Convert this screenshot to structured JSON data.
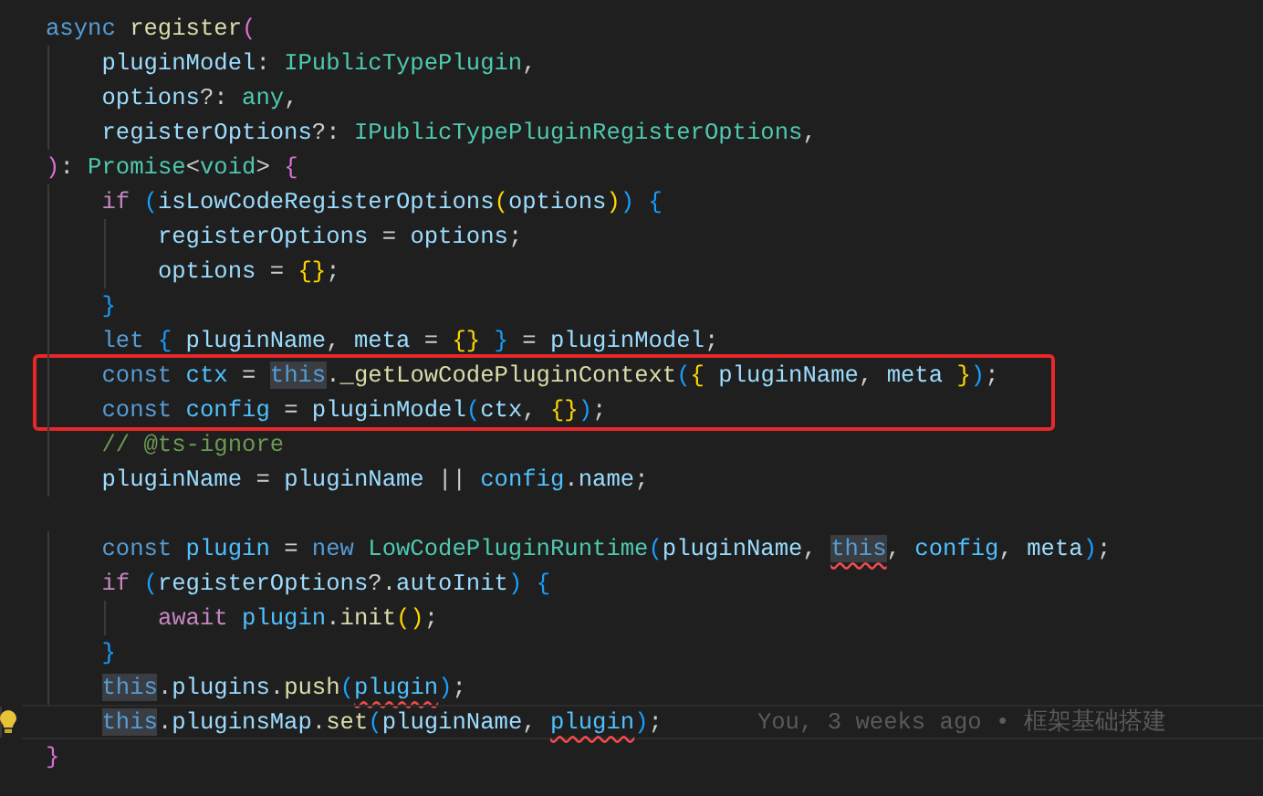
{
  "editor": {
    "lines": [
      {
        "kind": "code",
        "tokens": [
          {
            "kind": "kw",
            "text": "async "
          },
          {
            "kind": "fn",
            "text": "register"
          },
          {
            "kind": "b2",
            "text": "("
          }
        ]
      },
      {
        "kind": "code",
        "tokens": [
          {
            "kind": "var",
            "text": "    pluginModel"
          },
          {
            "kind": "punc",
            "text": ": "
          },
          {
            "kind": "type",
            "text": "IPublicTypePlugin"
          },
          {
            "kind": "punc",
            "text": ","
          }
        ]
      },
      {
        "kind": "code",
        "tokens": [
          {
            "kind": "var",
            "text": "    options"
          },
          {
            "kind": "punc",
            "text": "?: "
          },
          {
            "kind": "type",
            "text": "any"
          },
          {
            "kind": "punc",
            "text": ","
          }
        ]
      },
      {
        "kind": "code",
        "tokens": [
          {
            "kind": "var",
            "text": "    registerOptions"
          },
          {
            "kind": "punc",
            "text": "?: "
          },
          {
            "kind": "type",
            "text": "IPublicTypePluginRegisterOptions"
          },
          {
            "kind": "punc",
            "text": ","
          }
        ]
      },
      {
        "kind": "code",
        "tokens": [
          {
            "kind": "b2",
            "text": ")"
          },
          {
            "kind": "punc",
            "text": ": "
          },
          {
            "kind": "type",
            "text": "Promise"
          },
          {
            "kind": "punc",
            "text": "<"
          },
          {
            "kind": "type",
            "text": "void"
          },
          {
            "kind": "punc",
            "text": "> "
          },
          {
            "kind": "b2",
            "text": "{"
          }
        ]
      },
      {
        "kind": "code",
        "tokens": [
          {
            "kind": "ctrl",
            "text": "    if "
          },
          {
            "kind": "b3",
            "text": "("
          },
          {
            "kind": "var",
            "text": "isLowCodeRegisterOptions"
          },
          {
            "kind": "b1",
            "text": "("
          },
          {
            "kind": "var",
            "text": "options"
          },
          {
            "kind": "b1",
            "text": ")"
          },
          {
            "kind": "b3",
            "text": ")"
          },
          {
            "kind": "b3",
            "text": " {"
          }
        ]
      },
      {
        "kind": "code",
        "tokens": [
          {
            "kind": "var",
            "text": "        registerOptions"
          },
          {
            "kind": "punc",
            "text": " = "
          },
          {
            "kind": "var",
            "text": "options"
          },
          {
            "kind": "punc",
            "text": ";"
          }
        ]
      },
      {
        "kind": "code",
        "tokens": [
          {
            "kind": "var",
            "text": "        options"
          },
          {
            "kind": "punc",
            "text": " = "
          },
          {
            "kind": "b1",
            "text": "{}"
          },
          {
            "kind": "punc",
            "text": ";"
          }
        ]
      },
      {
        "kind": "code",
        "tokens": [
          {
            "kind": "b3",
            "text": "    }"
          }
        ]
      },
      {
        "kind": "code",
        "tokens": [
          {
            "kind": "kw",
            "text": "    let "
          },
          {
            "kind": "b3",
            "text": "{ "
          },
          {
            "kind": "var",
            "text": "pluginName"
          },
          {
            "kind": "punc",
            "text": ", "
          },
          {
            "kind": "var",
            "text": "meta"
          },
          {
            "kind": "punc",
            "text": " = "
          },
          {
            "kind": "b1",
            "text": "{}"
          },
          {
            "kind": "b3",
            "text": " }"
          },
          {
            "kind": "punc",
            "text": " = "
          },
          {
            "kind": "var",
            "text": "pluginModel"
          },
          {
            "kind": "punc",
            "text": ";"
          }
        ]
      },
      {
        "kind": "code",
        "boxed": true,
        "tokens": [
          {
            "kind": "kw",
            "text": "    const "
          },
          {
            "kind": "const",
            "text": "ctx"
          },
          {
            "kind": "punc",
            "text": " = "
          },
          {
            "kind": "kw",
            "text": "this",
            "highlighted": true
          },
          {
            "kind": "punc",
            "text": "."
          },
          {
            "kind": "fn",
            "text": "_getLowCodePluginContext"
          },
          {
            "kind": "b3",
            "text": "("
          },
          {
            "kind": "b1",
            "text": "{ "
          },
          {
            "kind": "var",
            "text": "pluginName"
          },
          {
            "kind": "punc",
            "text": ", "
          },
          {
            "kind": "var",
            "text": "meta"
          },
          {
            "kind": "b1",
            "text": " }"
          },
          {
            "kind": "b3",
            "text": ")"
          },
          {
            "kind": "punc",
            "text": ";"
          }
        ]
      },
      {
        "kind": "code",
        "boxed": true,
        "tokens": [
          {
            "kind": "kw",
            "text": "    const "
          },
          {
            "kind": "const",
            "text": "config"
          },
          {
            "kind": "punc",
            "text": " = "
          },
          {
            "kind": "var",
            "text": "pluginModel"
          },
          {
            "kind": "b3",
            "text": "("
          },
          {
            "kind": "var",
            "text": "ctx"
          },
          {
            "kind": "punc",
            "text": ", "
          },
          {
            "kind": "b1",
            "text": "{}"
          },
          {
            "kind": "b3",
            "text": ")"
          },
          {
            "kind": "punc",
            "text": ";"
          }
        ]
      },
      {
        "kind": "code",
        "tokens": [
          {
            "kind": "comment",
            "text": "    // @ts-ignore"
          }
        ]
      },
      {
        "kind": "code",
        "tokens": [
          {
            "kind": "var",
            "text": "    pluginName"
          },
          {
            "kind": "punc",
            "text": " = "
          },
          {
            "kind": "var",
            "text": "pluginName"
          },
          {
            "kind": "punc",
            "text": " || "
          },
          {
            "kind": "const",
            "text": "config"
          },
          {
            "kind": "punc",
            "text": "."
          },
          {
            "kind": "var",
            "text": "name"
          },
          {
            "kind": "punc",
            "text": ";"
          }
        ]
      },
      {
        "kind": "blank"
      },
      {
        "kind": "code",
        "tokens": [
          {
            "kind": "kw",
            "text": "    const "
          },
          {
            "kind": "const",
            "text": "plugin"
          },
          {
            "kind": "punc",
            "text": " = "
          },
          {
            "kind": "kw",
            "text": "new "
          },
          {
            "kind": "type",
            "text": "LowCodePluginRuntime"
          },
          {
            "kind": "b3",
            "text": "("
          },
          {
            "kind": "var",
            "text": "pluginName"
          },
          {
            "kind": "punc",
            "text": ", "
          },
          {
            "kind": "kw",
            "text": "this",
            "highlighted": true,
            "error": true
          },
          {
            "kind": "punc",
            "text": ", "
          },
          {
            "kind": "const",
            "text": "config"
          },
          {
            "kind": "punc",
            "text": ", "
          },
          {
            "kind": "var",
            "text": "meta"
          },
          {
            "kind": "b3",
            "text": ")"
          },
          {
            "kind": "punc",
            "text": ";"
          }
        ]
      },
      {
        "kind": "code",
        "tokens": [
          {
            "kind": "ctrl",
            "text": "    if "
          },
          {
            "kind": "b3",
            "text": "("
          },
          {
            "kind": "var",
            "text": "registerOptions"
          },
          {
            "kind": "punc",
            "text": "?."
          },
          {
            "kind": "var",
            "text": "autoInit"
          },
          {
            "kind": "b3",
            "text": ")"
          },
          {
            "kind": "b3",
            "text": " {"
          }
        ]
      },
      {
        "kind": "code",
        "tokens": [
          {
            "kind": "ctrl",
            "text": "        await "
          },
          {
            "kind": "const",
            "text": "plugin"
          },
          {
            "kind": "punc",
            "text": "."
          },
          {
            "kind": "fn",
            "text": "init"
          },
          {
            "kind": "b1",
            "text": "()"
          },
          {
            "kind": "punc",
            "text": ";"
          }
        ]
      },
      {
        "kind": "code",
        "tokens": [
          {
            "kind": "b3",
            "text": "    }"
          }
        ]
      },
      {
        "kind": "code",
        "tokens": [
          {
            "kind": "kw",
            "text": "    this",
            "highlighted": true
          },
          {
            "kind": "punc",
            "text": "."
          },
          {
            "kind": "var",
            "text": "plugins"
          },
          {
            "kind": "punc",
            "text": "."
          },
          {
            "kind": "fn",
            "text": "push"
          },
          {
            "kind": "b3",
            "text": "("
          },
          {
            "kind": "const",
            "text": "plugin",
            "error": true
          },
          {
            "kind": "b3",
            "text": ")"
          },
          {
            "kind": "punc",
            "text": ";"
          }
        ]
      },
      {
        "kind": "code",
        "current": true,
        "lightbulb": true,
        "blame": "You, 3 weeks ago • 框架基础搭建",
        "tokens": [
          {
            "kind": "kw",
            "text": "    this",
            "highlighted": true
          },
          {
            "kind": "punc",
            "text": "."
          },
          {
            "kind": "var",
            "text": "pluginsMap"
          },
          {
            "kind": "punc",
            "text": "."
          },
          {
            "kind": "fn",
            "text": "set"
          },
          {
            "kind": "b3",
            "text": "("
          },
          {
            "kind": "var",
            "text": "pluginName"
          },
          {
            "kind": "punc",
            "text": ", "
          },
          {
            "kind": "const",
            "text": "plugin",
            "error": true
          },
          {
            "kind": "b3",
            "text": ")"
          },
          {
            "kind": "punc",
            "text": ";"
          }
        ]
      },
      {
        "kind": "code",
        "tokens": [
          {
            "kind": "b2",
            "text": "}"
          }
        ]
      }
    ]
  }
}
